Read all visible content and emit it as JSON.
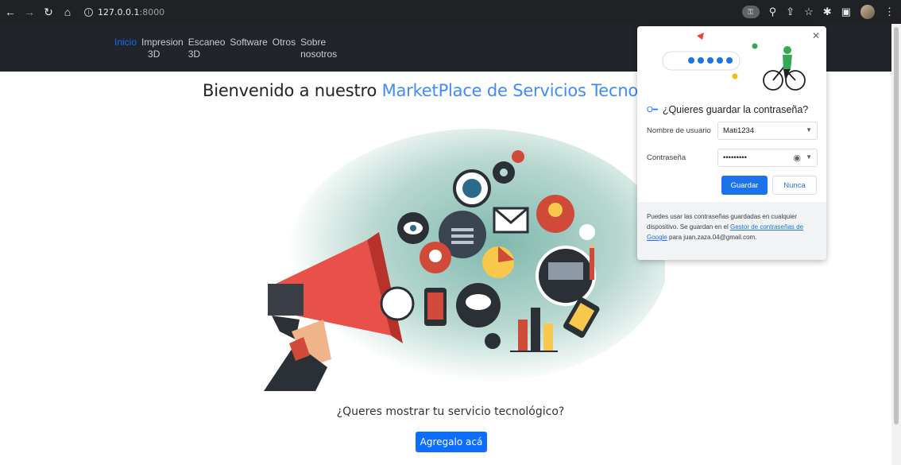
{
  "browser": {
    "url_host": "127.0.0.1",
    "url_port": ":8000"
  },
  "navbar": {
    "links": [
      {
        "line1": "Inicio",
        "line2": ""
      },
      {
        "line1": "Impresion",
        "line2": "3D"
      },
      {
        "line1": "Escaneo",
        "line2": "3D"
      },
      {
        "line1": "Software",
        "line2": ""
      },
      {
        "line1": "Otros",
        "line2": ""
      },
      {
        "line1": "Sobre",
        "line2": "nosotros"
      }
    ]
  },
  "main": {
    "headline_prefix": "Bienvenido a nuestro ",
    "headline_accent": "MarketPlace de Servicios Tecno",
    "prompt": "¿Queres mostrar tu servicio tecnológico?",
    "cta_label": "Agregalo acá"
  },
  "password_popup": {
    "title": "¿Quieres guardar la contraseña?",
    "username_label": "Nombre de usuario",
    "username_value": "Mati1234",
    "password_label": "Contraseña",
    "password_value": "•••••••••",
    "save_label": "Guardar",
    "never_label": "Nunca",
    "footer_text": "Puedes usar las contraseñas guardadas en cualquier dispositivo. Se guardan en el ",
    "footer_link": "Gestor de contraseñas de Google",
    "footer_suffix": " para juan.zaza.04@gmail.com."
  },
  "colors": {
    "accent": "#0d6efd",
    "navbar_bg": "#212529",
    "chrome_bg": "#202124"
  }
}
